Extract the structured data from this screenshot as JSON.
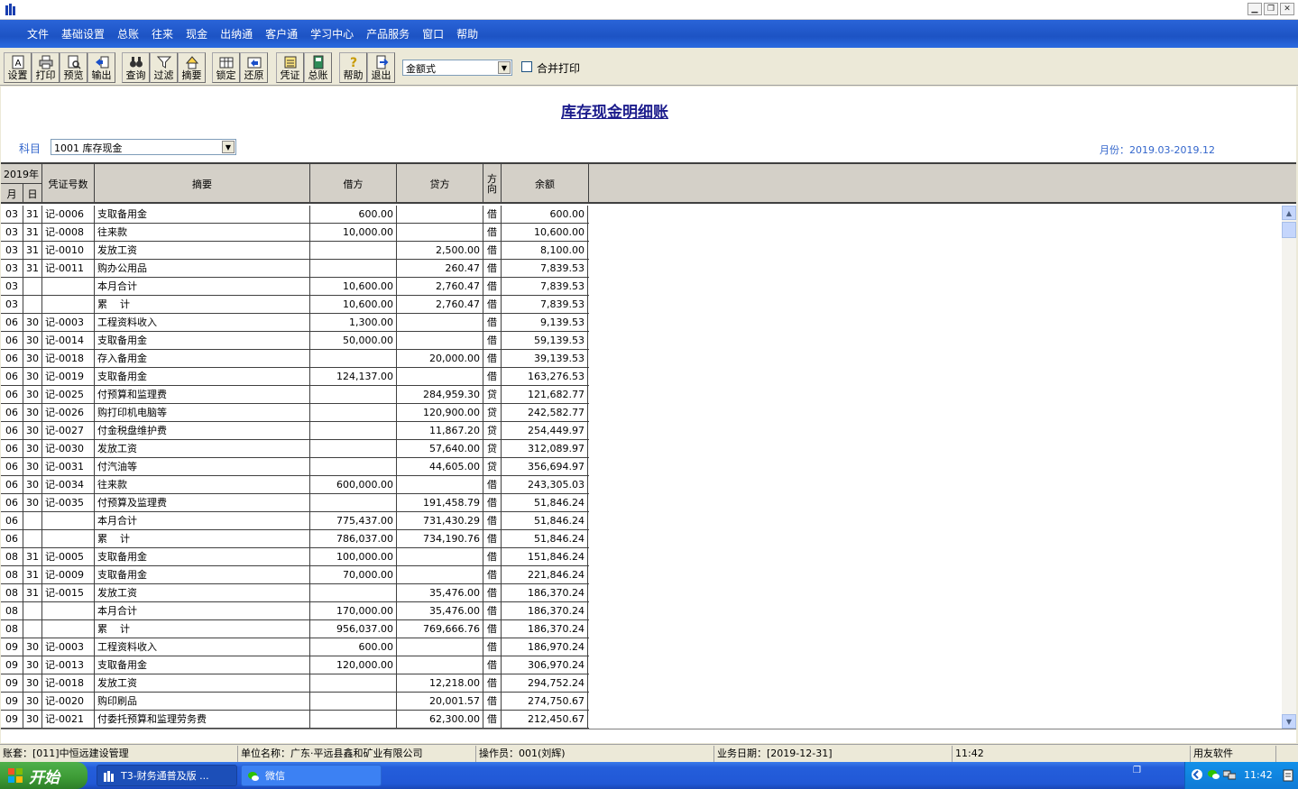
{
  "window": {
    "min_glyph": "▁",
    "restore_glyph": "❐",
    "close_glyph": "✕"
  },
  "menu": [
    "文件",
    "基础设置",
    "总账",
    "往来",
    "现金",
    "出纳通",
    "客户通",
    "学习中心",
    "产品服务",
    "窗口",
    "帮助"
  ],
  "toolbar": {
    "buttons": [
      {
        "label": "设置",
        "icon": "settings-icon"
      },
      {
        "label": "打印",
        "icon": "printer-icon"
      },
      {
        "label": "预览",
        "icon": "preview-icon"
      },
      {
        "label": "输出",
        "icon": "export-icon"
      },
      {
        "label": "查询",
        "icon": "binoculars-icon"
      },
      {
        "label": "过滤",
        "icon": "filter-icon"
      },
      {
        "label": "摘要",
        "icon": "summary-icon"
      },
      {
        "label": "锁定",
        "icon": "lock-icon"
      },
      {
        "label": "还原",
        "icon": "restore-icon"
      },
      {
        "label": "凭证",
        "icon": "voucher-icon"
      },
      {
        "label": "总账",
        "icon": "ledger-book-icon"
      },
      {
        "label": "帮助",
        "icon": "help-icon"
      },
      {
        "label": "退出",
        "icon": "exit-icon"
      }
    ],
    "format_value": "金额式",
    "merge_print_label": "合并打印"
  },
  "report": {
    "title": "库存现金明细账",
    "subject_label": "科目",
    "subject_value": "1001 库存现金",
    "period": "月份：2019.03-2019.12"
  },
  "table": {
    "year_header": "2019年",
    "month_header": "月",
    "day_header": "日",
    "voucher_header": "凭证号数",
    "summary_header": "摘要",
    "debit_header": "借方",
    "credit_header": "贷方",
    "direction_header": "方向",
    "balance_header": "余额",
    "rows": [
      [
        "03",
        "31",
        "记-0006",
        "支取备用金",
        "600.00",
        "",
        "借",
        "600.00"
      ],
      [
        "03",
        "31",
        "记-0008",
        "往来款",
        "10,000.00",
        "",
        "借",
        "10,600.00"
      ],
      [
        "03",
        "31",
        "记-0010",
        "发放工资",
        "",
        "2,500.00",
        "借",
        "8,100.00"
      ],
      [
        "03",
        "31",
        "记-0011",
        "购办公用品",
        "",
        "260.47",
        "借",
        "7,839.53"
      ],
      [
        "03",
        "",
        "",
        "本月合计",
        "10,600.00",
        "2,760.47",
        "借",
        "7,839.53"
      ],
      [
        "03",
        "",
        "",
        "累    计",
        "10,600.00",
        "2,760.47",
        "借",
        "7,839.53"
      ],
      [
        "06",
        "30",
        "记-0003",
        "工程资料收入",
        "1,300.00",
        "",
        "借",
        "9,139.53"
      ],
      [
        "06",
        "30",
        "记-0014",
        "支取备用金",
        "50,000.00",
        "",
        "借",
        "59,139.53"
      ],
      [
        "06",
        "30",
        "记-0018",
        "存入备用金",
        "",
        "20,000.00",
        "借",
        "39,139.53"
      ],
      [
        "06",
        "30",
        "记-0019",
        "支取备用金",
        "124,137.00",
        "",
        "借",
        "163,276.53"
      ],
      [
        "06",
        "30",
        "记-0025",
        "付预算和监理费",
        "",
        "284,959.30",
        "贷",
        "121,682.77"
      ],
      [
        "06",
        "30",
        "记-0026",
        "购打印机电脑等",
        "",
        "120,900.00",
        "贷",
        "242,582.77"
      ],
      [
        "06",
        "30",
        "记-0027",
        "付金税盘维护费",
        "",
        "11,867.20",
        "贷",
        "254,449.97"
      ],
      [
        "06",
        "30",
        "记-0030",
        "发放工资",
        "",
        "57,640.00",
        "贷",
        "312,089.97"
      ],
      [
        "06",
        "30",
        "记-0031",
        "付汽油等",
        "",
        "44,605.00",
        "贷",
        "356,694.97"
      ],
      [
        "06",
        "30",
        "记-0034",
        "往来款",
        "600,000.00",
        "",
        "借",
        "243,305.03"
      ],
      [
        "06",
        "30",
        "记-0035",
        "付预算及监理费",
        "",
        "191,458.79",
        "借",
        "51,846.24"
      ],
      [
        "06",
        "",
        "",
        "本月合计",
        "775,437.00",
        "731,430.29",
        "借",
        "51,846.24"
      ],
      [
        "06",
        "",
        "",
        "累    计",
        "786,037.00",
        "734,190.76",
        "借",
        "51,846.24"
      ],
      [
        "08",
        "31",
        "记-0005",
        "支取备用金",
        "100,000.00",
        "",
        "借",
        "151,846.24"
      ],
      [
        "08",
        "31",
        "记-0009",
        "支取备用金",
        "70,000.00",
        "",
        "借",
        "221,846.24"
      ],
      [
        "08",
        "31",
        "记-0015",
        "发放工资",
        "",
        "35,476.00",
        "借",
        "186,370.24"
      ],
      [
        "08",
        "",
        "",
        "本月合计",
        "170,000.00",
        "35,476.00",
        "借",
        "186,370.24"
      ],
      [
        "08",
        "",
        "",
        "累    计",
        "956,037.00",
        "769,666.76",
        "借",
        "186,370.24"
      ],
      [
        "09",
        "30",
        "记-0003",
        "工程资料收入",
        "600.00",
        "",
        "借",
        "186,970.24"
      ],
      [
        "09",
        "30",
        "记-0013",
        "支取备用金",
        "120,000.00",
        "",
        "借",
        "306,970.24"
      ],
      [
        "09",
        "30",
        "记-0018",
        "发放工资",
        "",
        "12,218.00",
        "借",
        "294,752.24"
      ],
      [
        "09",
        "30",
        "记-0020",
        "购印刷品",
        "",
        "20,001.57",
        "借",
        "274,750.67"
      ],
      [
        "09",
        "30",
        "记-0021",
        "付委托预算和监理劳务费",
        "",
        "62,300.00",
        "借",
        "212,450.67"
      ]
    ]
  },
  "status": {
    "account_set": "账套：[011]中恒远建设管理",
    "company": "单位名称：广东·平远县鑫和矿业有限公司",
    "operator": "操作员：001(刘辉)",
    "business_date": "业务日期：[2019-12-31]",
    "time": "11:42",
    "vendor": "用友软件"
  },
  "taskbar": {
    "start_label": "开始",
    "tasks": [
      "T3-财务通普及版 ...",
      "微信"
    ],
    "clock": "11:42"
  }
}
